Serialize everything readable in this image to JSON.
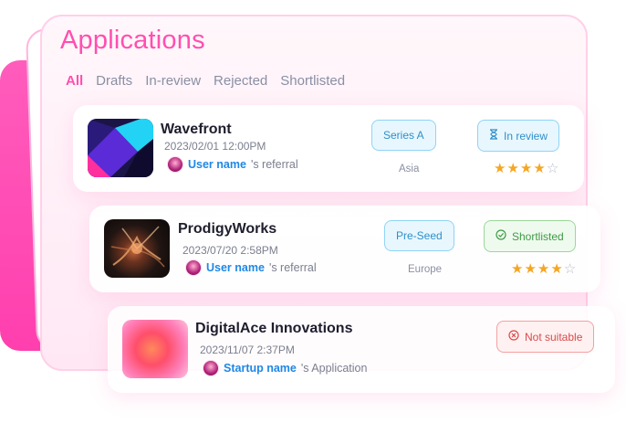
{
  "page": {
    "title": "Applications"
  },
  "tabs": [
    {
      "label": "All",
      "active": true
    },
    {
      "label": "Drafts",
      "active": false
    },
    {
      "label": "In-review",
      "active": false
    },
    {
      "label": "Rejected",
      "active": false
    },
    {
      "label": "Shortlisted",
      "active": false
    }
  ],
  "applications": [
    {
      "name": "Wavefront",
      "datetime": "2023/02/01 12:00PM",
      "referrer": "User name",
      "referrer_suffix": "'s referral",
      "stage": "Series A",
      "region": "Asia",
      "status": "In review",
      "status_icon": "hourglass-icon",
      "rating": 4,
      "rating_max": 5
    },
    {
      "name": "ProdigyWorks",
      "datetime": "2023/07/20 2:58PM",
      "referrer": "User name",
      "referrer_suffix": "'s referral",
      "stage": "Pre-Seed",
      "region": "Europe",
      "status": "Shortlisted",
      "status_icon": "check-circle-icon",
      "rating": 4,
      "rating_max": 5
    },
    {
      "name": "DigitalAce Innovations",
      "datetime": "2023/11/07 2:37PM",
      "referrer": "Startup name",
      "referrer_suffix": "'s Application",
      "status": "Not suitable",
      "status_icon": "x-circle-icon"
    }
  ],
  "colors": {
    "accent": "#ff4fb0",
    "link": "#1e88e5",
    "star": "#f5a623",
    "in_review": "#2f8fc9",
    "shortlisted": "#3f9a45",
    "not_suitable": "#d94a4a"
  }
}
